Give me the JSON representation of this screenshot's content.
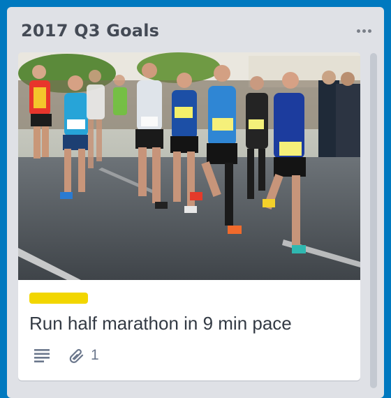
{
  "list": {
    "title": "2017 Q3 Goals",
    "menu_icon": "more-horizontal-icon"
  },
  "card": {
    "cover_image": "half-marathon-runners-photo",
    "label_color": "#f2d600",
    "title": "Run half marathon in 9 min pace",
    "badges": {
      "description_icon": "description-lines-icon",
      "attachment_icon": "paperclip-icon",
      "attachment_count": "1"
    }
  },
  "colors": {
    "board_background": "#0079bf",
    "list_background": "#dfe1e6",
    "card_background": "#ffffff"
  }
}
